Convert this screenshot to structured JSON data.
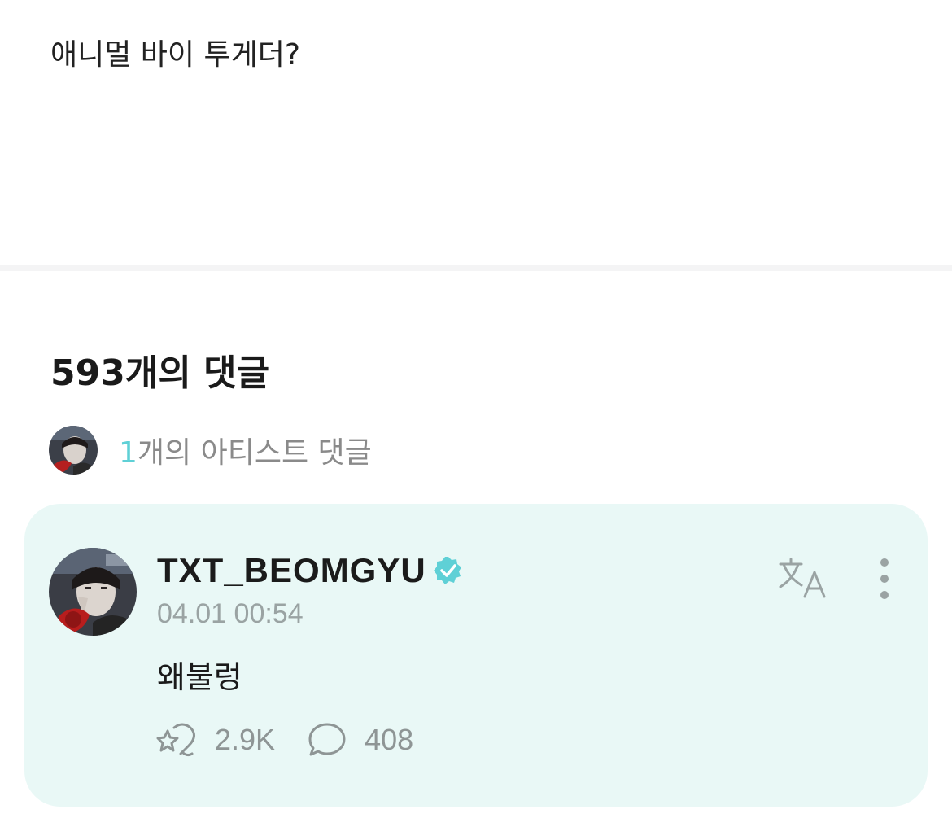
{
  "post": {
    "body_text": "애니멀 바이 투게더?"
  },
  "comments": {
    "header": "593개의 댓글",
    "artist_summary": {
      "count": "1",
      "label": "개의 아티스트 댓글"
    },
    "items": [
      {
        "author": "TXT_BEOMGYU",
        "verified": true,
        "timestamp": "04.01 00:54",
        "text": "왜불렁",
        "likes": "2.9K",
        "replies": "408"
      }
    ]
  },
  "icons": {
    "verified": "verified-badge-icon",
    "translate": "translate-icon",
    "more": "more-vertical-icon",
    "like": "heart-star-icon",
    "reply": "speech-bubble-icon"
  },
  "colors": {
    "accent": "#5fd0d6",
    "card_background": "#e9f8f6",
    "muted_text": "#8e9595"
  }
}
